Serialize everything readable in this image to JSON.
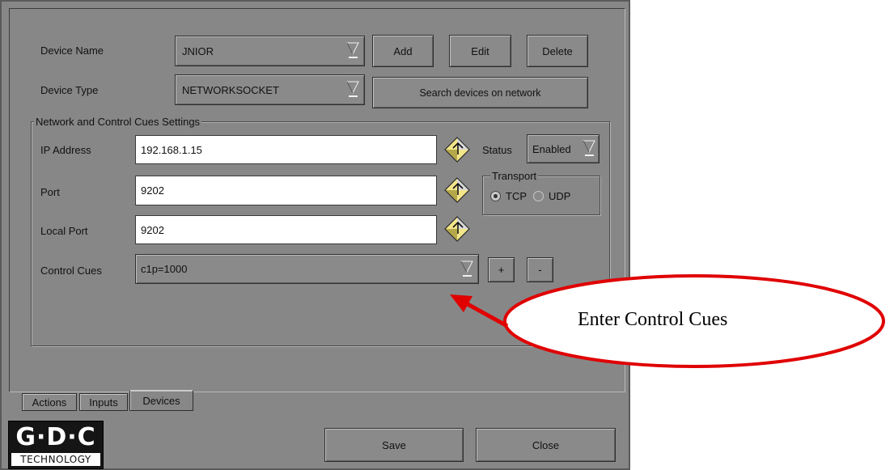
{
  "device": {
    "name_label": "Device Name",
    "name_value": "JNIOR",
    "type_label": "Device Type",
    "type_value": "NETWORKSOCKET",
    "add_label": "Add",
    "edit_label": "Edit",
    "delete_label": "Delete",
    "search_label": "Search devices on network"
  },
  "network": {
    "group_title": "Network and Control Cues Settings",
    "ip_label": "IP Address",
    "ip_value": "192.168.1.15",
    "port_label": "Port",
    "port_value": "9202",
    "local_port_label": "Local Port",
    "local_port_value": "9202",
    "status_label": "Status",
    "status_value": "Enabled",
    "transport_title": "Transport",
    "tcp_label": "TCP",
    "udp_label": "UDP",
    "transport_selected": "TCP",
    "cues_label": "Control Cues",
    "cues_value": "c1p=1000",
    "plus_label": "+",
    "minus_label": "-"
  },
  "tabs": [
    {
      "label": "Actions"
    },
    {
      "label": "Inputs"
    },
    {
      "label": "Devices"
    }
  ],
  "active_tab": "Devices",
  "footer": {
    "save_label": "Save",
    "close_label": "Close"
  },
  "logo": {
    "main": "G·D·C",
    "sub": "TECHNOLOGY"
  },
  "annotation": {
    "text": "Enter Control Cues",
    "color": "#e00000"
  },
  "colors": {
    "window_bg": "#878787",
    "arrow_icon_yellow": "#f2e58a"
  }
}
